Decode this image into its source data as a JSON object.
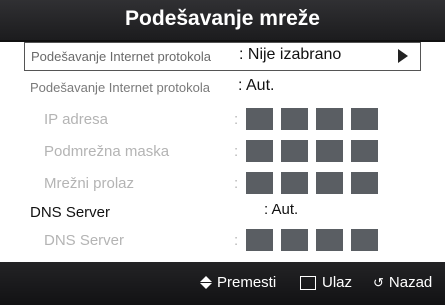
{
  "dialog": {
    "title": "Podešavanje mreže"
  },
  "rows": [
    {
      "label": "Podešavanje Internet protokola",
      "value": ": Nije izabrano"
    },
    {
      "label": "Podešavanje Internet protokola",
      "value": ": Aut."
    }
  ],
  "ip_fields": [
    {
      "label": "IP adresa",
      "colon": ":"
    },
    {
      "label": "Podmrežna maska",
      "colon": ":"
    },
    {
      "label": "Mrežni prolaz",
      "colon": ":"
    }
  ],
  "dns": {
    "label": "DNS Server",
    "value": ": Aut.",
    "field_label": "DNS Server",
    "field_colon": ":"
  },
  "footer": {
    "move": "Premesti",
    "enter": "Ulaz",
    "back": "Nazad"
  },
  "icons": {
    "move": "up-down-arrows-icon",
    "enter": "enter-icon",
    "back": "return-icon"
  }
}
